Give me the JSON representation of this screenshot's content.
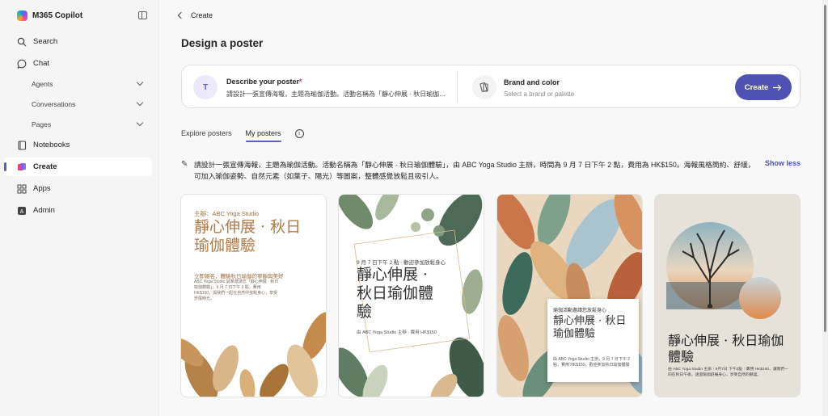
{
  "app": {
    "title": "M365 Copilot"
  },
  "nav": {
    "search": "Search",
    "chat": "Chat",
    "agents": "Agents",
    "conversations": "Conversations",
    "pages": "Pages",
    "notebooks": "Notebooks",
    "create": "Create",
    "apps": "Apps",
    "admin": "Admin"
  },
  "breadcrumb": {
    "back_label": "Create"
  },
  "page": {
    "title": "Design a poster"
  },
  "composer": {
    "prompt_label": "Describe your poster",
    "required_mark": "*",
    "prompt_preview": "請設計一張宣傳海報，主題為瑜伽活動。活動名稱為「靜心伸展 · 秋日瑜伽體驗」，由 ABC Yoga Studio 主辦",
    "brand_label": "Brand and color",
    "brand_placeholder": "Select a brand or palette",
    "create_label": "Create"
  },
  "tabs": [
    {
      "label": "Explore posters",
      "active": false
    },
    {
      "label": "My posters",
      "active": true
    }
  ],
  "prompt_full": "請設計一張宣傳海報，主題為瑜伽活動。活動名稱為「靜心伸展 · 秋日瑜伽體驗」，由 ABC Yoga Studio 主辦，時間為 9 月 7 日下午 2 點，費用為 HK$150。海報風格簡約、舒緩，可加入瑜伽姿勢、自然元素（如葉子、陽光）等圖案，整體感覺放鬆且吸引人。",
  "show_less": "Show less",
  "posters": [
    {
      "org": "主辦：ABC Yoga Studio",
      "title": "靜心伸展 · 秋日瑜伽體驗",
      "subtitle": "立即報名，體驗秋日瑜伽的寧靜與美好",
      "desc": "ABC Yoga Studio 誠摯邀請您「靜心伸展 · 秋日瑜伽體驗」，9 月 7 日下午 2 點，費用 HK$150，與我們一起在自然中放鬆身心，享受舒展時光。"
    },
    {
      "date": "9 月 7 日下午 2 點 · 歡迎參加放鬆身心",
      "title": "靜心伸展 · 秋日瑜伽體驗",
      "org": "由 ABC Yoga Studio 主辦 · 費用 HK$150"
    },
    {
      "tag": "瑜伽活動邀請您放鬆身心",
      "title": "靜心伸展 · 秋日瑜伽體驗",
      "desc": "由 ABC Yoga Studio 主辦，9 月 7 日下午 2 點，費用 HK$150，歡迎參加秋日瑜伽體驗"
    },
    {
      "title": "靜心伸展 · 秋日瑜伽體驗",
      "desc": "由 ABC Yoga Studio 主辦｜9月7日 下午2點｜費用 HK$150，讓我們一同在秋日午後，透過瑜伽舒展身心，享受自然的靜謐。"
    }
  ],
  "colors": {
    "accent": "#4f52b2",
    "active_indicator": "#5b5fc7",
    "required": "#c4314b"
  }
}
